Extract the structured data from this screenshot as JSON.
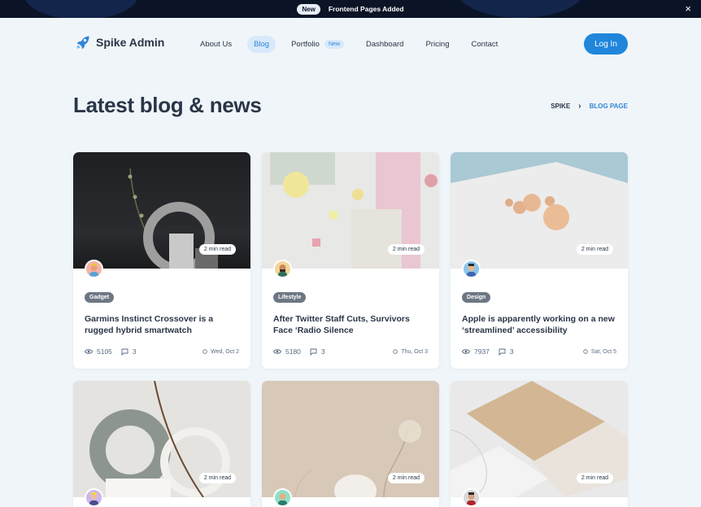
{
  "announcement": {
    "badge": "New",
    "message": "Frontend Pages Added",
    "close": "×"
  },
  "header": {
    "brand": "Spike Admin",
    "nav": [
      {
        "label": "About Us"
      },
      {
        "label": "Blog"
      },
      {
        "label": "Portfolio",
        "badge": "New"
      },
      {
        "label": "Dashboard"
      },
      {
        "label": "Pricing"
      },
      {
        "label": "Contact"
      }
    ],
    "login": "Log In"
  },
  "page": {
    "title": "Latest blog & news",
    "breadcrumb": {
      "home": "SPIKE",
      "separator": "›",
      "current": "BLOG PAGE"
    }
  },
  "posts": [
    {
      "read_time": "2 min read",
      "category": "Gadget",
      "title": "Garmins Instinct Crossover is a rugged hybrid smartwatch",
      "views": "5105",
      "comments": "3",
      "date": "Wed, Oct 2"
    },
    {
      "read_time": "2 min read",
      "category": "Lifestyle",
      "title": "After Twitter Staff Cuts, Survivors Face ‘Radio Silence",
      "views": "5180",
      "comments": "3",
      "date": "Thu, Oct 3"
    },
    {
      "read_time": "2 min read",
      "category": "Design",
      "title": "Apple is apparently working on a new ‘streamlined’ accessibility",
      "views": "7937",
      "comments": "3",
      "date": "Sat, Oct 5"
    },
    {
      "read_time": "2 min read"
    },
    {
      "read_time": "2 min read"
    },
    {
      "read_time": "2 min read"
    }
  ],
  "colors": {
    "accent": "#1f86db",
    "dark": "#0b1426",
    "text": "#2a3547"
  }
}
